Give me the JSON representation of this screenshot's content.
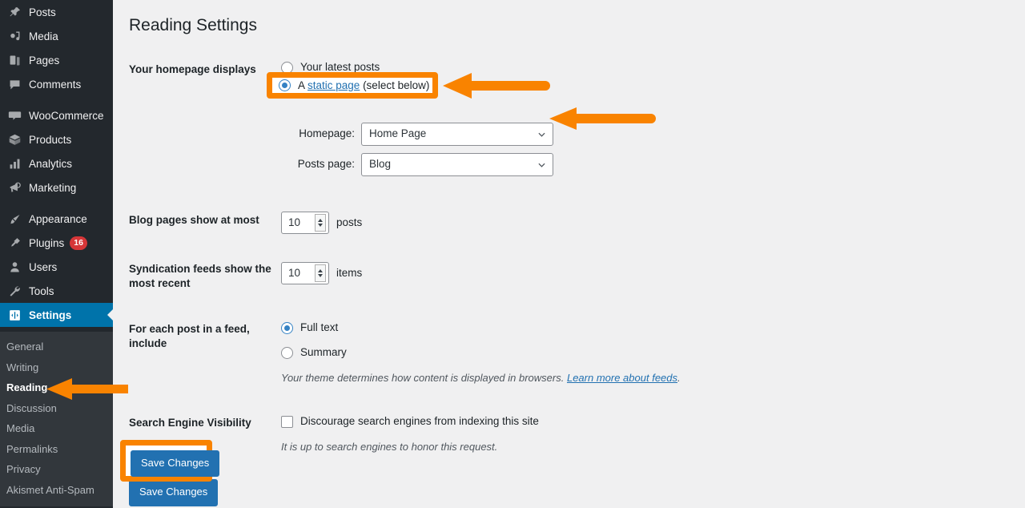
{
  "theme": {
    "sidebar_bg": "#23282d",
    "submenu_bg": "#32373c",
    "current_blue": "#0073aa",
    "content_bg": "#f0f0f1",
    "accent_orange": "#f98300",
    "link_blue": "#2271b1",
    "badge_red": "#d63638",
    "button_blue": "#2271b1"
  },
  "sidebar": {
    "items": [
      {
        "label": "Posts",
        "icon": "pin-icon",
        "current": false,
        "badge": null
      },
      {
        "label": "Media",
        "icon": "media-icon",
        "current": false,
        "badge": null
      },
      {
        "label": "Pages",
        "icon": "pages-icon",
        "current": false,
        "badge": null
      },
      {
        "label": "Comments",
        "icon": "comments-icon",
        "current": false,
        "badge": null
      },
      {
        "label": "WooCommerce",
        "icon": "woocommerce-icon",
        "current": false,
        "badge": null
      },
      {
        "label": "Products",
        "icon": "products-box-icon",
        "current": false,
        "badge": null
      },
      {
        "label": "Analytics",
        "icon": "analytics-bars-icon",
        "current": false,
        "badge": null
      },
      {
        "label": "Marketing",
        "icon": "marketing-megaphone-icon",
        "current": false,
        "badge": null
      },
      {
        "label": "Appearance",
        "icon": "appearance-brush-icon",
        "current": false,
        "badge": null
      },
      {
        "label": "Plugins",
        "icon": "plugins-plug-icon",
        "current": false,
        "badge": "16"
      },
      {
        "label": "Users",
        "icon": "users-icon",
        "current": false,
        "badge": null
      },
      {
        "label": "Tools",
        "icon": "tools-wrench-icon",
        "current": false,
        "badge": null
      },
      {
        "label": "Settings",
        "icon": "settings-icon",
        "current": true,
        "badge": null
      }
    ],
    "submenu": [
      {
        "label": "General",
        "current": false
      },
      {
        "label": "Writing",
        "current": false
      },
      {
        "label": "Reading",
        "current": true
      },
      {
        "label": "Discussion",
        "current": false
      },
      {
        "label": "Media",
        "current": false
      },
      {
        "label": "Permalinks",
        "current": false
      },
      {
        "label": "Privacy",
        "current": false
      },
      {
        "label": "Akismet Anti-Spam",
        "current": false
      }
    ]
  },
  "page": {
    "title": "Reading Settings"
  },
  "homepage_displays": {
    "label": "Your homepage displays",
    "options": [
      {
        "text": "Your latest posts",
        "checked": false
      },
      {
        "text_before": "A ",
        "link": "static page",
        "text_after": " (select below)",
        "checked": true
      }
    ],
    "homepage_select": {
      "label": "Homepage:",
      "value": "Home Page"
    },
    "posts_page_select": {
      "label": "Posts page:",
      "value": "Blog"
    }
  },
  "blog_pages": {
    "label": "Blog pages show at most",
    "value": "10",
    "unit": "posts"
  },
  "syndication_feeds": {
    "label": "Syndication feeds show the most recent",
    "value": "10",
    "unit": "items"
  },
  "feed_include": {
    "label": "For each post in a feed, include",
    "options": [
      {
        "text": "Full text",
        "checked": true
      },
      {
        "text": "Summary",
        "checked": false
      }
    ],
    "help_text": "Your theme determines how content is displayed in browsers. ",
    "help_link": "Learn more about feeds",
    "help_suffix": "."
  },
  "search_engine_visibility": {
    "label": "Search Engine Visibility",
    "checkbox_label": "Discourage search engines from indexing this site",
    "checked": false,
    "help_text": "It is up to search engines to honor this request."
  },
  "submit": {
    "save_label": "Save Changes"
  },
  "annotations": {
    "arrow_static_page": "arrow-pointing-to-static-page-option",
    "arrow_homepage_select": "arrow-pointing-to-homepage-dropdown",
    "arrow_reading_menu": "arrow-pointing-to-reading-menu-item",
    "highlight_static_page": "highlight-box-static-page",
    "highlight_save": "highlight-box-save-changes"
  }
}
